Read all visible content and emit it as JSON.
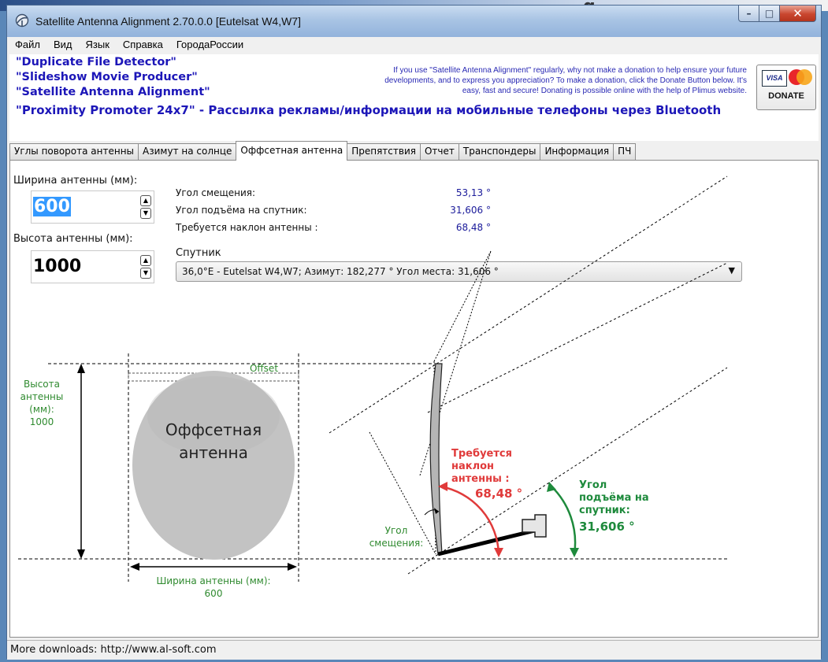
{
  "window": {
    "title": "Satellite Antenna Alignment 2.70.0.0 [Eutelsat W4,W7]"
  },
  "menu": [
    "Файл",
    "Вид",
    "Язык",
    "Справка",
    "ГородаРоссии"
  ],
  "banner": {
    "promos": [
      "\"Duplicate File Detector\"",
      "\"Slideshow Movie Producer\"",
      "\"Satellite Antenna Alignment\"",
      "\"Proximity Promoter 24x7\" - Рассылка рекламы/информации на мобильные телефоны через Bluetooth"
    ],
    "donate_lines": [
      "If you use \"Satellite Antenna Alignment\" regularly, why not make a donation to help ensure your future",
      "developments, and to express you appreciation? To make a donation, click the Donate Button below. It's",
      "easy, fast and secure! Donating is possible online with the help of Plimus website."
    ],
    "visa": "VISA",
    "donate_button": "DONATE"
  },
  "tabs": [
    {
      "label": "Углы поворота антенны",
      "active": false
    },
    {
      "label": "Азимут на солнце",
      "active": false
    },
    {
      "label": "Оффсетная антенна",
      "active": true
    },
    {
      "label": "Препятствия",
      "active": false
    },
    {
      "label": "Отчет",
      "active": false
    },
    {
      "label": "Транспондеры",
      "active": false
    },
    {
      "label": "Информация",
      "active": false
    },
    {
      "label": "ПЧ",
      "active": false
    }
  ],
  "form": {
    "width_label": "Ширина антенны (мм):",
    "width_value": "600",
    "height_label": "Высота антенны (мм):",
    "height_value": "1000",
    "offset_angle_label": "Угол смещения:",
    "offset_angle_value": "53,13 °",
    "elevation_label": "Угол подъёма на спутник:",
    "elevation_value": "31,606 °",
    "tilt_label": "Требуется наклон антенны :",
    "tilt_value": "68,48 °",
    "satellite_label": "Спутник",
    "satellite_selected": "36,0°E - Eutelsat W4,W7;  Азимут: 182,277 °  Угол места: 31,606 °"
  },
  "diagram": {
    "offset_label": "Offset",
    "height_caption": [
      "Высота",
      "антенны",
      "(мм):",
      "1000"
    ],
    "width_caption": [
      "Ширина антенны (мм):",
      "600"
    ],
    "dish_title": [
      "Оффсетная",
      "антенна"
    ],
    "tilt_caption": [
      "Требуется",
      "наклон",
      "антенны :",
      "68,48 °"
    ],
    "elevation_caption": [
      "Угол",
      "подъёма на",
      "спутник:",
      "31,606 °"
    ],
    "offset_caption": [
      "Угол",
      "смещения:"
    ],
    "colors": {
      "tilt": "#e03a3a",
      "elevation": "#1e8a3c",
      "dims": "#2f8a2f",
      "dish": "#c3c3c3"
    }
  },
  "status": {
    "text": "More downloads: http://www.al-soft.com"
  }
}
